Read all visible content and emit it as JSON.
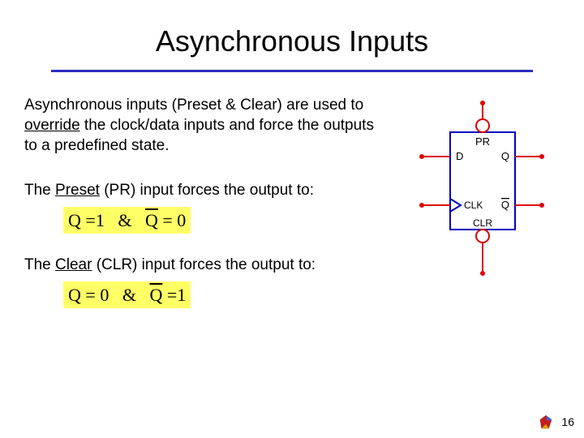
{
  "title": "Asynchronous Inputs",
  "para1": {
    "pre": "Asynchronous inputs (Preset & Clear) are used to ",
    "u": "override",
    "post": " the clock/data inputs and force the outputs to a predefined state."
  },
  "para2": {
    "pre": "The ",
    "u": "Preset",
    "post": " (PR) input forces the output to:"
  },
  "eq1": {
    "lhs1": "Q",
    "op1": "=",
    "v1": "1",
    "amp": "&",
    "lhs2": "Q",
    "op2": "=",
    "v2": "0"
  },
  "para3": {
    "pre": "The ",
    "u": "Clear",
    "post": " (CLR) input forces the output to:"
  },
  "eq2": {
    "lhs1": "Q",
    "op1": "=",
    "v1": "0",
    "amp": "&",
    "lhs2": "Q",
    "op2": "=",
    "v2": "1"
  },
  "ff": {
    "pr": "PR",
    "d": "D",
    "q": "Q",
    "qbar": "Q",
    "clk": "CLK",
    "clr": "CLR"
  },
  "page_number": "16"
}
